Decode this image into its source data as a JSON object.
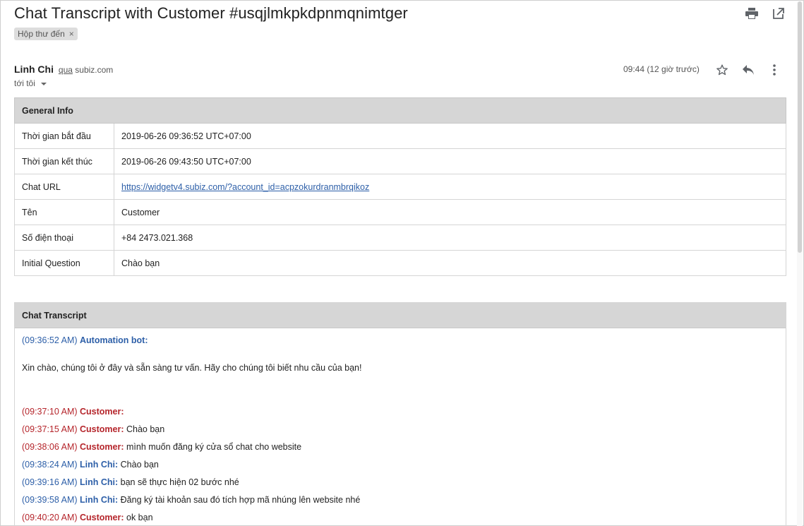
{
  "subject": "Chat Transcript with Customer #usqjlmkpkdpnmqnimtger",
  "label_chip": "Hộp thư đến",
  "label_chip_close": "×",
  "sender": {
    "name": "Linh Chi",
    "via_word": "qua",
    "via_domain": "subiz.com",
    "to": "tới tôi"
  },
  "time": "09:44 (12 giờ trước)",
  "icons": {
    "print": "print-icon",
    "open_new": "open-in-new-icon",
    "star": "star-icon",
    "reply": "reply-icon",
    "more": "more-vertical-icon"
  },
  "general_info": {
    "title": "General Info",
    "rows": [
      {
        "key": "Thời gian bắt đầu",
        "value": "2019-06-26 09:36:52 UTC+07:00"
      },
      {
        "key": "Thời gian kết thúc",
        "value": "2019-06-26 09:43:50 UTC+07:00"
      },
      {
        "key": "Chat URL",
        "value": "https://widgetv4.subiz.com/?account_id=acpzokurdranmbrqikoz"
      },
      {
        "key": "Tên",
        "value": "Customer"
      },
      {
        "key": "Số điện thoại",
        "value": "+84 2473.021.368"
      },
      {
        "key": "Initial Question",
        "value": "Chào bạn"
      }
    ]
  },
  "transcript": {
    "title": "Chat Transcript",
    "bot_time": "(09:36:52 AM)",
    "bot_name": "Automation bot:",
    "bot_message": "Xin chào, chúng tôi ở đây và sẵn sàng tư vấn. Hãy cho chúng tôi biết nhu cầu của bạn!",
    "messages": [
      {
        "time": "(09:37:10 AM)",
        "who": "Customer:",
        "text": ""
      },
      {
        "time": "(09:37:15 AM)",
        "who": "Customer:",
        "text": "Chào bạn"
      },
      {
        "time": "(09:38:06 AM)",
        "who": "Customer:",
        "text": "mình muốn đăng ký cửa sổ chat cho website"
      },
      {
        "time": "(09:38:24 AM)",
        "who": "Linh Chi:",
        "text": "Chào bạn"
      },
      {
        "time": "(09:39:16 AM)",
        "who": "Linh Chi:",
        "text": "bạn sẽ thực hiện 02 bước nhé"
      },
      {
        "time": "(09:39:58 AM)",
        "who": "Linh Chi:",
        "text": "Đăng ký tài khoản sau đó tích hợp mã nhúng lên website nhé"
      },
      {
        "time": "(09:40:20 AM)",
        "who": "Customer:",
        "text": "ok bạn"
      }
    ]
  },
  "colors": {
    "customer": "#b5252b",
    "agent": "#2d5fa8",
    "header_bg": "#d6d6d6"
  }
}
